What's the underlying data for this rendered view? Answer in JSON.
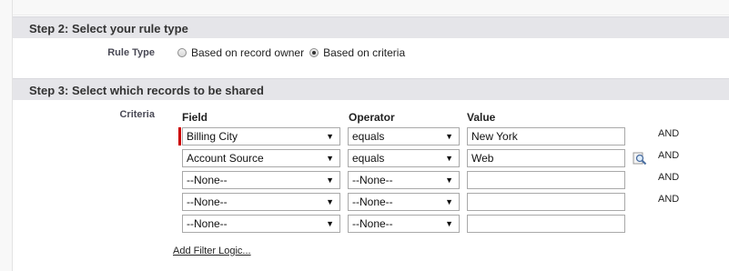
{
  "step2": {
    "title": "Step 2: Select your rule type",
    "rule_type_label": "Rule Type",
    "options": [
      {
        "label": "Based on record owner",
        "checked": false
      },
      {
        "label": "Based on criteria",
        "checked": true
      }
    ]
  },
  "step3": {
    "title": "Step 3: Select which records to be shared",
    "criteria_label": "Criteria",
    "columns": {
      "field": "Field",
      "operator": "Operator",
      "value": "Value"
    },
    "rows": [
      {
        "field": "Billing City",
        "operator": "equals",
        "value": "New York",
        "connector": "AND",
        "lookup": false
      },
      {
        "field": "Account Source",
        "operator": "equals",
        "value": "Web",
        "connector": "AND",
        "lookup": true
      },
      {
        "field": "--None--",
        "operator": "--None--",
        "value": "",
        "connector": "AND",
        "lookup": false
      },
      {
        "field": "--None--",
        "operator": "--None--",
        "value": "",
        "connector": "AND",
        "lookup": false
      },
      {
        "field": "--None--",
        "operator": "--None--",
        "value": "",
        "connector": "",
        "lookup": false
      }
    ],
    "add_filter_logic": "Add Filter Logic..."
  },
  "icons": {
    "lookup": "lookup-magnifier-icon",
    "dropdown": "chevron-down-icon"
  },
  "colors": {
    "header_bg": "#e5e5e9",
    "required": "#cc0000"
  }
}
